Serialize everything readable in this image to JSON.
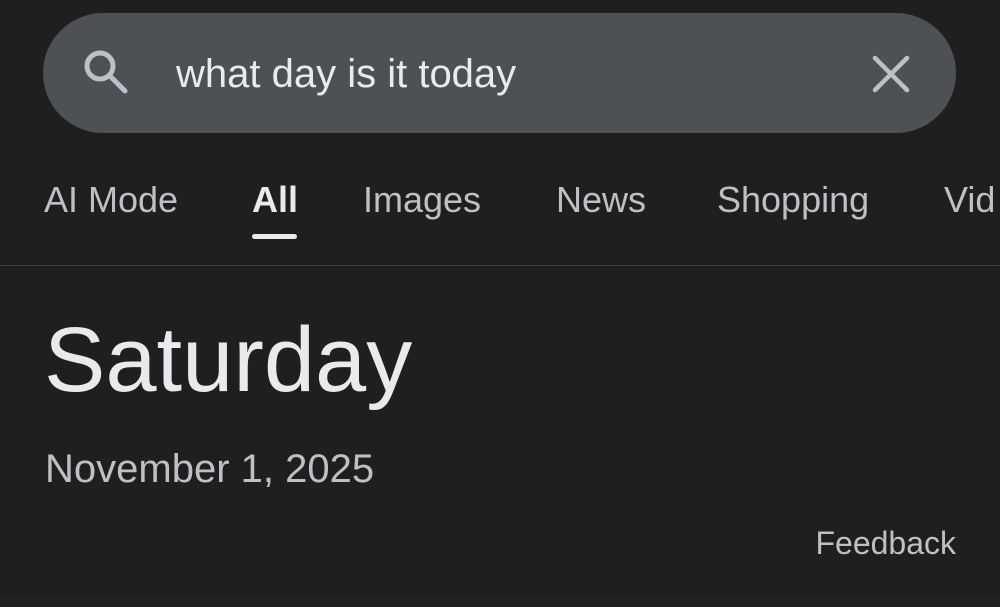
{
  "search": {
    "query": "what day is it today",
    "search_icon": "search-icon",
    "clear_icon": "close-icon"
  },
  "tabs": [
    {
      "label": "AI Mode",
      "active": false
    },
    {
      "label": "All",
      "active": true
    },
    {
      "label": "Images",
      "active": false
    },
    {
      "label": "News",
      "active": false
    },
    {
      "label": "Shopping",
      "active": false
    },
    {
      "label": "Vid",
      "active": false
    }
  ],
  "result": {
    "day": "Saturday",
    "date": "November 1, 2025",
    "feedback_label": "Feedback"
  },
  "colors": {
    "background": "#1f1f1f",
    "search_bar": "#4d5156",
    "primary_text": "#e8eaed",
    "secondary_text": "#bdc1c6"
  }
}
